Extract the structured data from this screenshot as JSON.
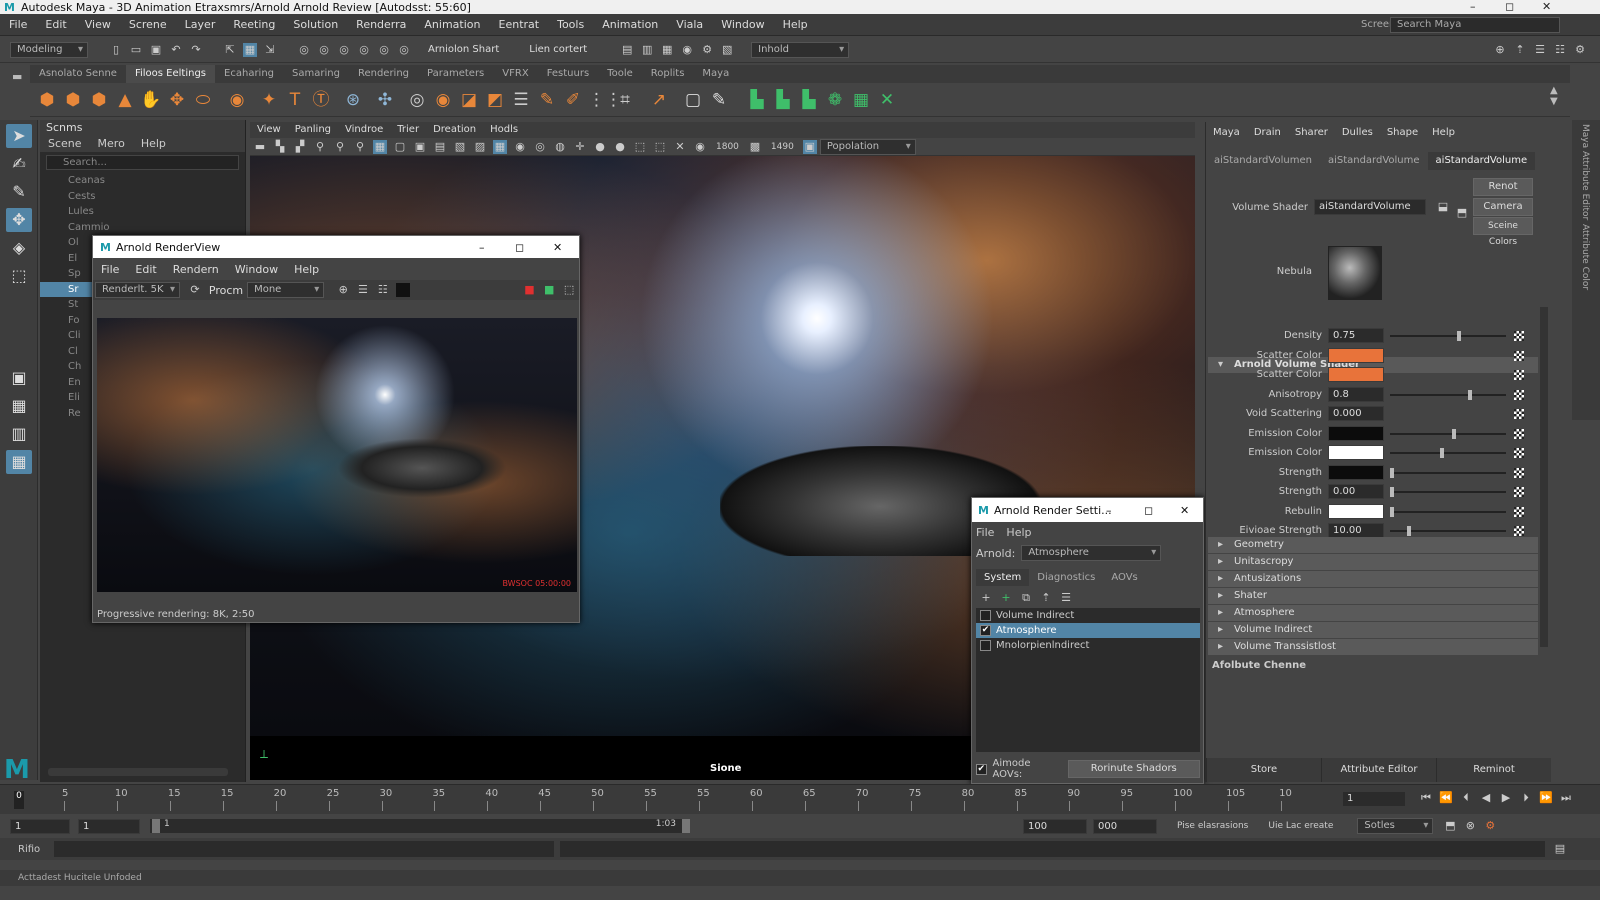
{
  "window": {
    "title": "Autodesk Maya - 3D Animation Etraxsmrs/Arnold Arnold Review [Autodsst: 55:60]",
    "min": "–",
    "max": "◻",
    "close": "✕"
  },
  "menubar": {
    "items": [
      "File",
      "Edit",
      "View",
      "Screne",
      "Layer",
      "Reeting",
      "Solution",
      "Renderra",
      "Animation",
      "Eentrat",
      "Tools",
      "Animation",
      "Viala",
      "Window",
      "Help"
    ],
    "screenshot_label": "Screenrao:",
    "search_placeholder": "Search Maya"
  },
  "statusline": {
    "mode": "Modeling",
    "menu_set": "Arniolon Shart",
    "select_label": "Lien cortert",
    "live": "Inhold"
  },
  "shelf": {
    "tabs": [
      "Asnolato Senne",
      "Filoos Eeltings",
      "Ecaharing",
      "Samaring",
      "Rendering",
      "Parameters",
      "VFRX",
      "Festuurs",
      "Toole",
      "Roplits",
      "Maya"
    ],
    "active_tab": "Filoos Eeltings"
  },
  "outliner": {
    "title": "Scnms",
    "menu": [
      "Scene",
      "Mero",
      "Help"
    ],
    "search_placeholder": "Search...",
    "items": [
      "Ceanas",
      "Cests",
      "Lules",
      "Cammio",
      "Ol",
      "El",
      "Sp",
      "Sr",
      "St",
      "Fo",
      "Cli",
      "Cl",
      "Ch",
      "En",
      "Eli",
      "Re"
    ],
    "selected_index": 7
  },
  "viewport": {
    "menu": [
      "View",
      "Panling",
      "Vindroe",
      "Trier",
      "Dreation",
      "Hodls"
    ],
    "res_w": "1800",
    "res_h": "1490",
    "display_mode": "Popolation",
    "label": "Sione"
  },
  "renderview": {
    "title": "Arnold RenderView",
    "menu": [
      "File",
      "Edit",
      "Rendern",
      "Window",
      "Help"
    ],
    "camera": "Renderlt. 5K",
    "procm_label": "Procm",
    "procm_value": "Mone",
    "stamp": "BWSOC 05:00:00",
    "status": "Progressive rendering: 8K, 2:50"
  },
  "render_settings": {
    "title": "Arnold Render Setti...",
    "menu": [
      "File",
      "Help"
    ],
    "renderer_label": "Arnold:",
    "renderer_value": "Atmosphere",
    "tabs": [
      "System",
      "Diagnostics",
      "AOVs"
    ],
    "active_tab": "System",
    "list": [
      {
        "label": "Volume Indirect",
        "checked": false
      },
      {
        "label": "Atmosphere",
        "checked": true
      },
      {
        "label": "Mnolorpienlndirect",
        "checked": false
      }
    ],
    "aovs_label": "Aimode AOVs:",
    "aovs_checked": true,
    "button": "Rorinute Shadors"
  },
  "attribute_editor": {
    "menu": [
      "Maya",
      "Drain",
      "Sharer",
      "Dulles",
      "Shape",
      "Help"
    ],
    "tabs": [
      "aiStandardVolumen",
      "aiStandardVolume",
      "aiStandardVolume"
    ],
    "active_tab_index": 2,
    "volume_shader_label": "Volume Shader",
    "volume_shader_value": "aiStandardVolume",
    "buttons": [
      "Renot",
      "Camera",
      "Sceine Colors"
    ],
    "swatch_label": "Nebula",
    "section_title": "Arnold Volume Shader",
    "attrs": [
      {
        "label": "Density",
        "value": "0.75",
        "kind": "num",
        "slider": 0.6
      },
      {
        "label": "Scatter Color",
        "value": "",
        "kind": "color",
        "color": "#e8733a"
      },
      {
        "label": "Scatter Color",
        "value": "",
        "kind": "color",
        "color": "#e8733a"
      },
      {
        "label": "Anisotropy",
        "value": "0.8",
        "kind": "num",
        "slider": 0.7
      },
      {
        "label": "Void Scattering",
        "value": "0.000",
        "kind": "num",
        "slider": null
      },
      {
        "label": "Emission Color",
        "value": "",
        "kind": "color",
        "color": "#0c0c0c",
        "slider": 0.55
      },
      {
        "label": "Emission Color",
        "value": "",
        "kind": "color",
        "color": "#ffffff",
        "slider": 0.45
      },
      {
        "label": "Strength",
        "value": "",
        "kind": "color",
        "color": "#0c0c0c",
        "slider": 0.0
      },
      {
        "label": "Strength",
        "value": "0.00",
        "kind": "num",
        "slider": 0.0
      },
      {
        "label": "Rebulin",
        "value": "",
        "kind": "color",
        "color": "#ffffff",
        "slider": 0.0
      },
      {
        "label": "Eivioae Strength",
        "value": "10.00",
        "kind": "num",
        "slider": 0.15
      }
    ],
    "sections": [
      "Geometry",
      "Unitascropy",
      "Antusizations",
      "Shater",
      "Atmosphere",
      "Volume Indirect",
      "Volume Transsistlost"
    ],
    "notes_label": "Afolbute Chenne",
    "footer": [
      "Store",
      "Attribute Editor",
      "Reminot"
    ]
  },
  "timeslider": {
    "ticks": [
      "5",
      "10",
      "15",
      "15",
      "20",
      "25",
      "30",
      "35",
      "40",
      "45",
      "50",
      "55",
      "55",
      "60",
      "65",
      "70",
      "75",
      "80",
      "85",
      "90",
      "95",
      "100",
      "105",
      "10"
    ],
    "current_frame": "0",
    "current_time": "1"
  },
  "rangebar": {
    "start": "1",
    "start2": "1",
    "range_start": "1",
    "range_end": "1:03",
    "end": "100",
    "end2": "000",
    "fps_label": "Pise elasrasions",
    "char_label": "Uie Lac ereate",
    "anim_layer": "Sotles"
  },
  "commandline": {
    "label": "Rifio"
  },
  "helpline": {
    "text": "Acttadest Hucitele Unfoded"
  },
  "right_tabs": [
    "Maya Attribute Editor",
    "Attribute Color"
  ],
  "colors": {
    "accent": "#5285a6",
    "maya_teal": "#1b9aaa"
  }
}
